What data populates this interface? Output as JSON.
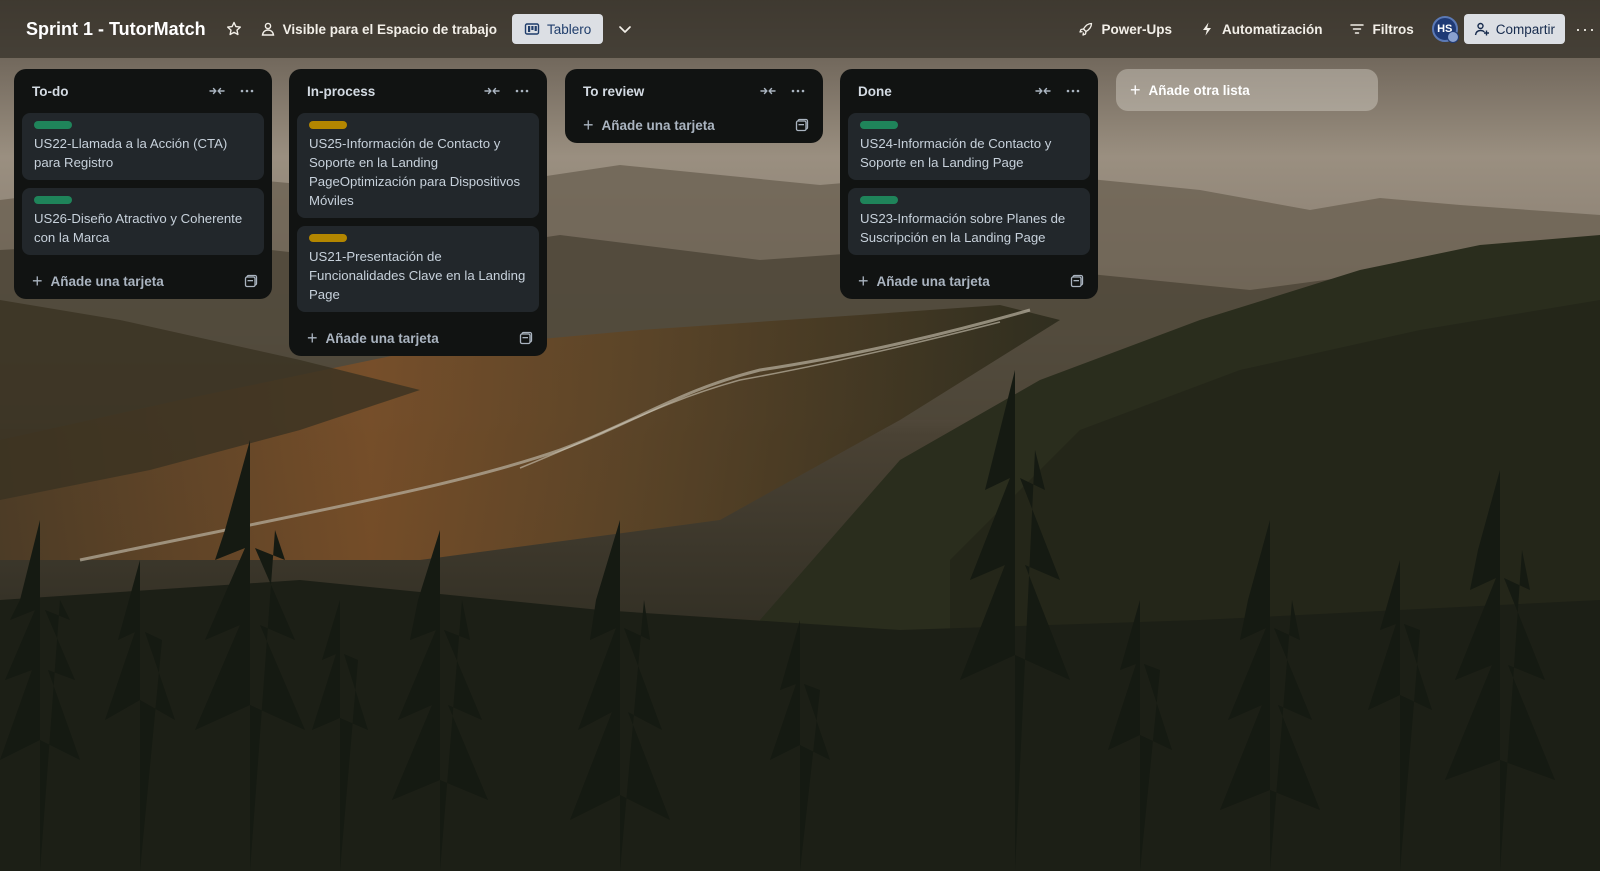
{
  "header": {
    "board_title": "Sprint 1 - TutorMatch",
    "visibility_label": "Visible para el Espacio de trabajo",
    "view_label": "Tablero",
    "power_ups_label": "Power-Ups",
    "automation_label": "Automatización",
    "filters_label": "Filtros",
    "avatar_initials": "HS",
    "share_label": "Compartir",
    "more_label": "···"
  },
  "lists": [
    {
      "title": "To-do",
      "cards": [
        {
          "label_color": "#1f845a",
          "text": "US22-Llamada a la Acción (CTA) para Registro"
        },
        {
          "label_color": "#1f845a",
          "text": "US26-Diseño Atractivo y Coherente con la Marca"
        }
      ],
      "add_card_label": "Añade una tarjeta"
    },
    {
      "title": "In-process",
      "cards": [
        {
          "label_color": "#b38600",
          "text": "US25-Información de Contacto y Soporte en la Landing PageOptimización para Dispositivos Móviles"
        },
        {
          "label_color": "#b38600",
          "text": "US21-Presentación de Funcionalidades Clave en la Landing Page"
        }
      ],
      "add_card_label": "Añade una tarjeta"
    },
    {
      "title": "To review",
      "cards": [],
      "add_card_label": "Añade una tarjeta"
    },
    {
      "title": "Done",
      "cards": [
        {
          "label_color": "#1f845a",
          "text": "US24-Información de Contacto y Soporte en la Landing Page"
        },
        {
          "label_color": "#1f845a",
          "text": "US23-Información sobre Planes de Suscripción en la Landing Page"
        }
      ],
      "add_card_label": "Añade una tarjeta"
    }
  ],
  "add_list_label": "Añade otra lista",
  "icons": {
    "star": "star-icon",
    "visibility": "people-icon",
    "view": "board-icon",
    "chevron": "chevron-down-icon",
    "power_ups": "rocket-icon",
    "automation": "lightning-icon",
    "filters": "filter-icon",
    "share": "add-person-icon",
    "collapse": "collapse-icon",
    "list_menu": "more-icon",
    "template": "template-icon",
    "plus": "plus-icon"
  }
}
